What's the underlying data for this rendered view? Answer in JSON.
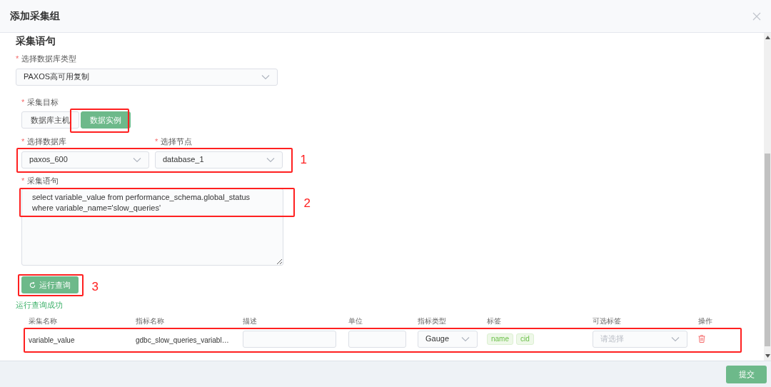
{
  "dialog": {
    "title": "添加采集组"
  },
  "section_title": "采集语句",
  "db_type": {
    "mark": "*",
    "label": "选择数据库类型",
    "value": "PAXOS高可用复制"
  },
  "target": {
    "mark": "*",
    "label": "采集目标",
    "options": [
      {
        "label": "数据库主机",
        "selected": false
      },
      {
        "label": "数据实例",
        "selected": true
      }
    ]
  },
  "database": {
    "mark": "*",
    "label": "选择数据库",
    "value": "paxos_600"
  },
  "node": {
    "mark": "*",
    "label": "选择节点",
    "value": "database_1"
  },
  "statement": {
    "mark": "*",
    "label": "采集语句",
    "value": "select variable_value from performance_schema.global_status where variable_name='slow_queries'"
  },
  "run_button": "运行查询",
  "status": "运行查询成功",
  "table": {
    "columns": [
      "采集名称",
      "指标名称",
      "描述",
      "单位",
      "指标类型",
      "标签",
      "可选标签",
      "操作"
    ],
    "rows": [
      {
        "collect_name": "variable_value",
        "metric_name": "gdbc_slow_queries_variabl…",
        "metric_type": "Gauge",
        "tags": [
          "name",
          "cid"
        ],
        "optional_tags_placeholder": "请选择"
      }
    ]
  },
  "submit": "提交",
  "annotations": [
    {
      "label": "1"
    },
    {
      "label": "2"
    },
    {
      "label": "3"
    }
  ]
}
